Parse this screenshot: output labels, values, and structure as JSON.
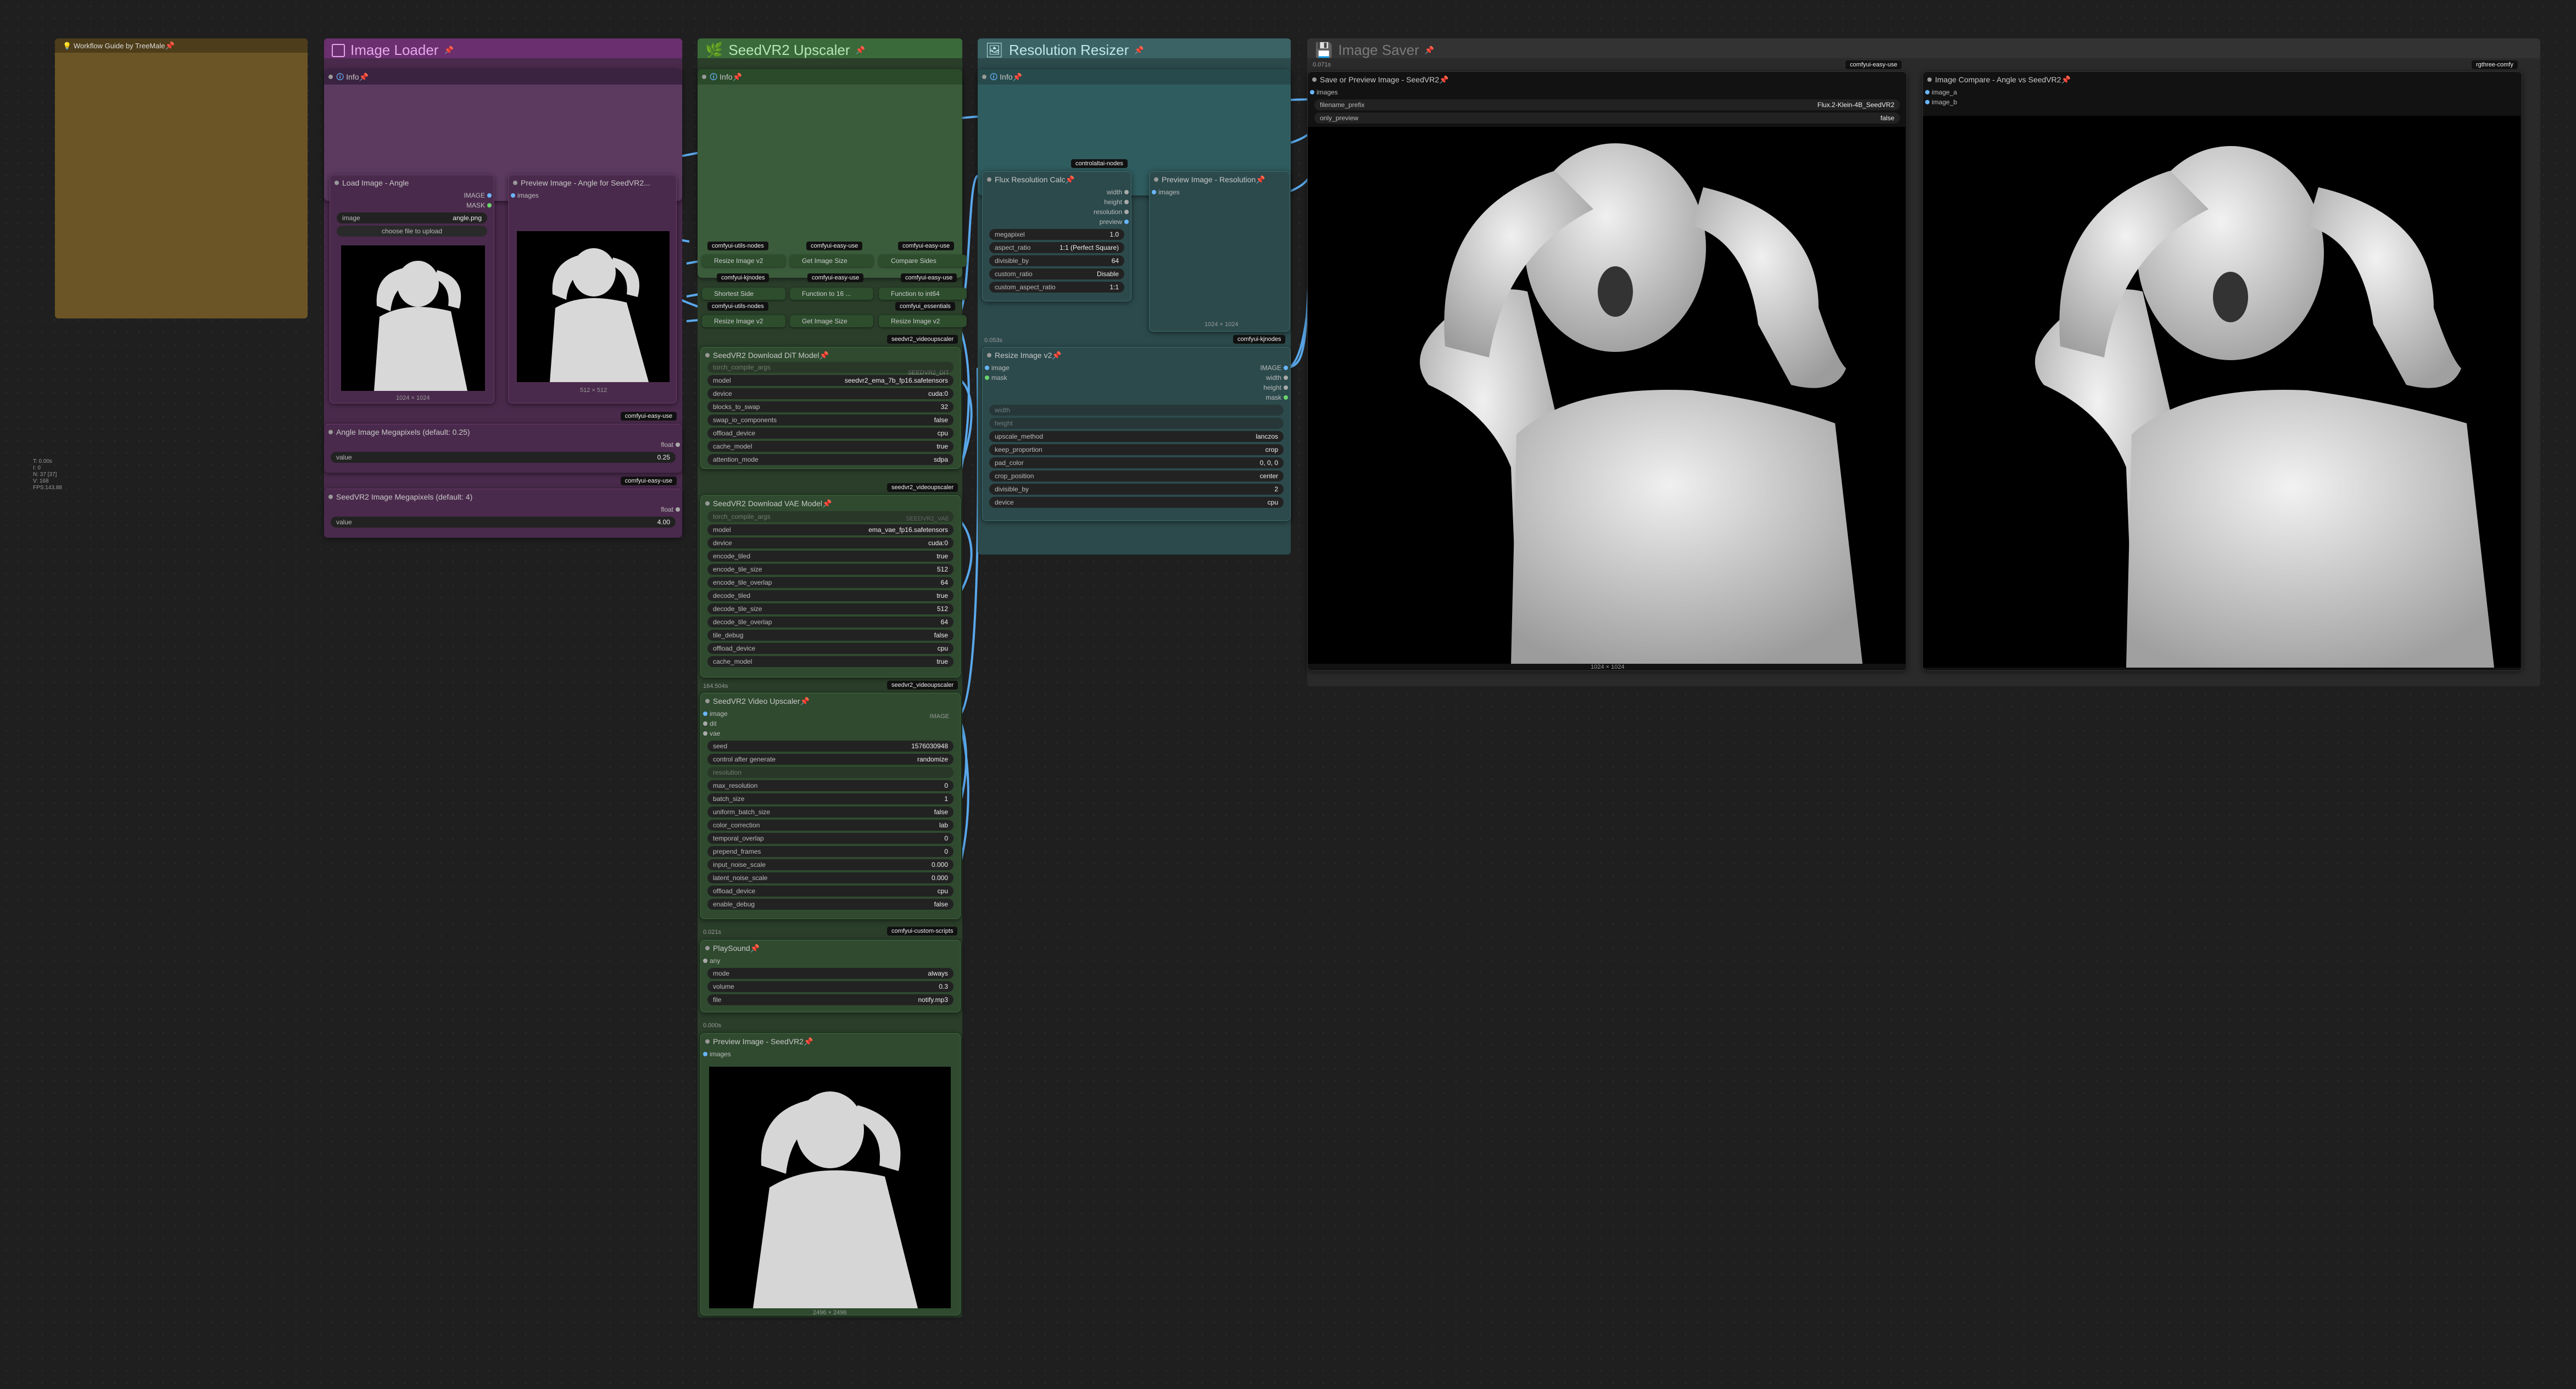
{
  "groups": {
    "image_loader": {
      "title": "Image Loader",
      "color": "#5a2a5e"
    },
    "seedvr2_upscaler": {
      "title": "SeedVR2 Upscaler",
      "color": "#2e4e2e"
    },
    "resolution_resizer": {
      "title": "Resolution Resizer",
      "color": "#2a4e52"
    },
    "image_saver": {
      "title": "Image Saver",
      "color": "#2a2a2a"
    }
  },
  "workflow_guide": {
    "title": "Workflow Guide by TreeMale"
  },
  "info_label": "Info",
  "load_image": {
    "title": "Load Image - Angle",
    "outputs": [
      "IMAGE",
      "MASK"
    ],
    "image_label": "image",
    "image_value": "angle.png",
    "upload_label": "choose file to upload",
    "dims": "1024 × 1024"
  },
  "preview_angle": {
    "title": "Preview Image - Angle for SeedVR2...",
    "input": "images",
    "dims": "512 × 512"
  },
  "angle_mp": {
    "title": "Angle Image Megapixels (default: 0.25)",
    "out": "float",
    "label": "value",
    "value": "0.25",
    "badge": "comfyui-easy-use"
  },
  "seedvr2_mp": {
    "title": "SeedVR2 Image Megapixels (default: 4)",
    "out": "float",
    "label": "value",
    "value": "4.00",
    "badge": "comfyui-easy-use"
  },
  "badge_easy_use": "comfyui-easy-use",
  "mini_nodes": {
    "resize_a": "Resize Image v2",
    "get_size_a": "Get Image Size",
    "compare_sides": "Compare Sides",
    "shortest_side": "Shortest Side",
    "func_a": "Function to 16 ...",
    "func_b": "Function to int64",
    "resize_b": "Resize Image v2",
    "get_size_b": "Get Image Size",
    "resize_c": "Resize Image v2",
    "badge_kj": "comfyui-kjnodes",
    "badge_utils": "comfyui-utils-nodes",
    "badge_essentials": "comfyui_essentials",
    "badge_seedvr2": "seedvr2_videoupscaler"
  },
  "dit_model": {
    "title": "SeedVR2 Download DiT Model",
    "tag": "SEEDVR2_DIT",
    "widgets": [
      {
        "k": "torch_compile_args",
        "v": "",
        "dis": true
      },
      {
        "k": "model",
        "v": "seedvr2_ema_7b_fp16.safetensors"
      },
      {
        "k": "device",
        "v": "cuda:0"
      },
      {
        "k": "blocks_to_swap",
        "v": "32"
      },
      {
        "k": "swap_io_components",
        "v": "false"
      },
      {
        "k": "offload_device",
        "v": "cpu"
      },
      {
        "k": "cache_model",
        "v": "true"
      },
      {
        "k": "attention_mode",
        "v": "sdpa"
      }
    ],
    "badge": "seedvr2_videoupscaler"
  },
  "vae_model": {
    "title": "SeedVR2 Download VAE Model",
    "tag": "SEEDVR2_VAE",
    "widgets": [
      {
        "k": "torch_compile_args",
        "v": "",
        "dis": true
      },
      {
        "k": "model",
        "v": "ema_vae_fp16.safetensors"
      },
      {
        "k": "device",
        "v": "cuda:0"
      },
      {
        "k": "encode_tiled",
        "v": "true"
      },
      {
        "k": "encode_tile_size",
        "v": "512"
      },
      {
        "k": "encode_tile_overlap",
        "v": "64"
      },
      {
        "k": "decode_tiled",
        "v": "true"
      },
      {
        "k": "decode_tile_size",
        "v": "512"
      },
      {
        "k": "decode_tile_overlap",
        "v": "64"
      },
      {
        "k": "tile_debug",
        "v": "false"
      },
      {
        "k": "offload_device",
        "v": "cpu"
      },
      {
        "k": "cache_model",
        "v": "true"
      }
    ],
    "badge": "seedvr2_videoupscaler",
    "time": "164.504s"
  },
  "video_upscaler": {
    "title": "SeedVR2 Video Upscaler",
    "out": "IMAGE",
    "inputs": [
      "image",
      "dit",
      "vae"
    ],
    "widgets": [
      {
        "k": "seed",
        "v": "1576030948"
      },
      {
        "k": "control after generate",
        "v": "randomize"
      },
      {
        "k": "resolution",
        "v": "",
        "dis": true
      },
      {
        "k": "max_resolution",
        "v": "0"
      },
      {
        "k": "batch_size",
        "v": "1"
      },
      {
        "k": "uniform_batch_size",
        "v": "false"
      },
      {
        "k": "color_correction",
        "v": "lab"
      },
      {
        "k": "temporal_overlap",
        "v": "0"
      },
      {
        "k": "prepend_frames",
        "v": "0"
      },
      {
        "k": "input_noise_scale",
        "v": "0.000"
      },
      {
        "k": "latent_noise_scale",
        "v": "0.000"
      },
      {
        "k": "offload_device",
        "v": "cpu"
      },
      {
        "k": "enable_debug",
        "v": "false"
      }
    ],
    "time": "0.021s",
    "badge": "comfyui-custom-scripts"
  },
  "play_sound": {
    "title": "PlaySound",
    "input": "any",
    "widgets": [
      {
        "k": "mode",
        "v": "always"
      },
      {
        "k": "volume",
        "v": "0.3"
      },
      {
        "k": "file",
        "v": "notify.mp3"
      }
    ],
    "time": "0.000s"
  },
  "preview_seedvr2": {
    "title": "Preview Image - SeedVR2",
    "input": "images",
    "dims": "2496 × 2496"
  },
  "flux_calc": {
    "title": "Flux Resolution Calc",
    "outputs": [
      "width",
      "height",
      "resolution",
      "preview"
    ],
    "widgets": [
      {
        "k": "megapixel",
        "v": "1.0"
      },
      {
        "k": "aspect_ratio",
        "v": "1:1 (Perfect Square)"
      },
      {
        "k": "divisible_by",
        "v": "64"
      },
      {
        "k": "custom_ratio",
        "v": "Disable"
      },
      {
        "k": "custom_aspect_ratio",
        "v": "1:1"
      }
    ],
    "badge": "controlaltai-nodes",
    "time": "0.053s"
  },
  "preview_resolution": {
    "title": "Preview Image - Resolution",
    "input": "images",
    "dims": "1024 × 1024",
    "badge": "comfyui-kjnodes"
  },
  "resize_v2": {
    "title": "Resize Image v2",
    "inputs": [
      "image",
      "mask"
    ],
    "outputs": [
      "IMAGE",
      "width",
      "height",
      "mask"
    ],
    "widgets": [
      {
        "k": "width",
        "v": "",
        "dis": true
      },
      {
        "k": "height",
        "v": "",
        "dis": true
      },
      {
        "k": "upscale_method",
        "v": "lanczos"
      },
      {
        "k": "keep_proportion",
        "v": "crop"
      },
      {
        "k": "pad_color",
        "v": "0, 0, 0"
      },
      {
        "k": "crop_position",
        "v": "center"
      },
      {
        "k": "divisible_by",
        "v": "2"
      },
      {
        "k": "device",
        "v": "cpu"
      }
    ]
  },
  "save_preview": {
    "title": "Save or Preview Image - SeedVR2",
    "input": "images",
    "widgets": [
      {
        "k": "filename_prefix",
        "v": "Flux.2-Klein-4B_SeedVR2"
      },
      {
        "k": "only_preview",
        "v": "false"
      }
    ],
    "dims": "1024 × 1024",
    "time": "0.071s",
    "badge": "comfyui-easy-use"
  },
  "image_compare": {
    "title": "Image Compare - Angle vs SeedVR2",
    "inputs": [
      "image_a",
      "image_b"
    ],
    "badge": "rgthree-comfy"
  },
  "stats": [
    "T: 0.00s",
    "I: 0",
    "N: 37 [37]",
    "V: 168",
    "FPS:143.88"
  ],
  "colors": {
    "accent_wire": "#69b6ff",
    "pin": "#e94b6a"
  }
}
